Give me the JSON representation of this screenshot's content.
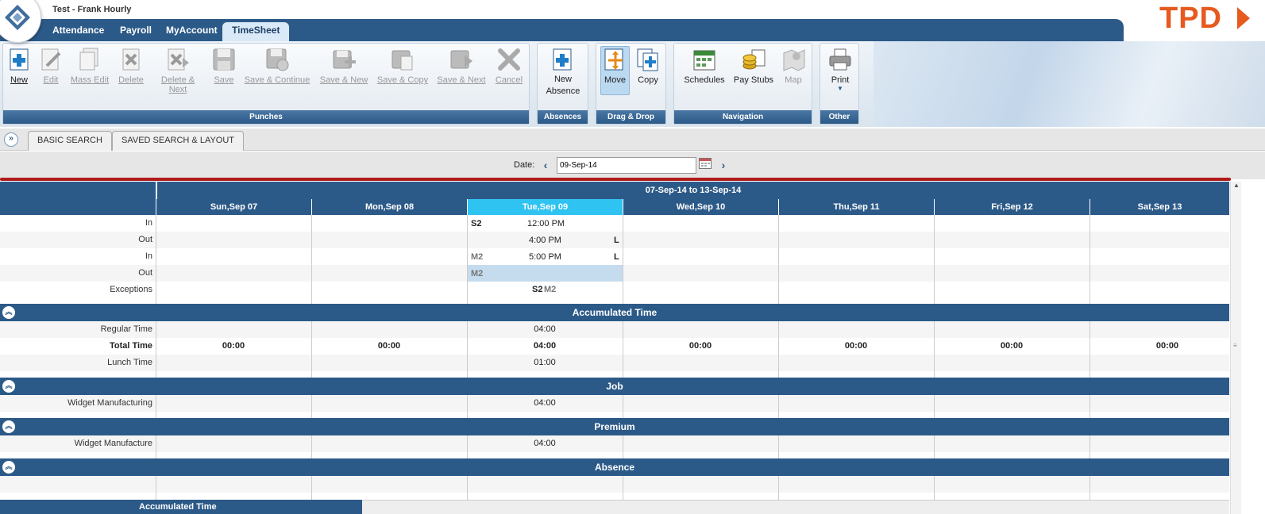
{
  "header": {
    "user_title": "Test - Frank Hourly",
    "brand": "TPD"
  },
  "nav": {
    "tabs": [
      "Attendance",
      "Payroll",
      "MyAccount",
      "TimeSheet"
    ],
    "active": "TimeSheet"
  },
  "ribbon": {
    "punches": {
      "label": "Punches",
      "buttons": [
        "New",
        "Edit",
        "Mass Edit",
        "Delete",
        "Delete & Next",
        "Save",
        "Save & Continue",
        "Save & New",
        "Save & Copy",
        "Save & Next",
        "Cancel"
      ]
    },
    "absences": {
      "label": "Absences",
      "button_line1": "New",
      "button_line2": "Absence"
    },
    "dragdrop": {
      "label": "Drag & Drop",
      "move": "Move",
      "copy": "Copy"
    },
    "navigation": {
      "label": "Navigation",
      "schedules": "Schedules",
      "paystubs": "Pay Stubs",
      "map": "Map"
    },
    "other": {
      "label": "Other",
      "print": "Print"
    }
  },
  "search": {
    "basic_tab": "BASIC SEARCH",
    "saved_tab": "SAVED SEARCH & LAYOUT"
  },
  "date": {
    "label": "Date:",
    "value": "09-Sep-14"
  },
  "grid": {
    "range": "07-Sep-14 to 13-Sep-14",
    "days": [
      "Sun,Sep 07",
      "Mon,Sep 08",
      "Tue,Sep 09",
      "Wed,Sep 10",
      "Thu,Sep 11",
      "Fri,Sep 12",
      "Sat,Sep 13"
    ],
    "punch_rows": [
      "In",
      "Out",
      "In",
      "Out",
      "Exceptions"
    ],
    "punches": {
      "in1_code": "S2",
      "in1_time": "12:00 PM",
      "out1_time": "4:00 PM",
      "out1_flag": "L",
      "in2_code": "M2",
      "in2_time": "5:00 PM",
      "in2_flag": "L",
      "out2_code": "M2",
      "exc1": "S2",
      "exc2": "M2"
    },
    "accumulated": {
      "title": "Accumulated Time",
      "regular_label": "Regular Time",
      "regular_value": "04:00",
      "total_label": "Total Time",
      "total_values": [
        "00:00",
        "00:00",
        "04:00",
        "00:00",
        "00:00",
        "00:00",
        "00:00"
      ],
      "lunch_label": "Lunch Time",
      "lunch_value": "01:00"
    },
    "job": {
      "title": "Job",
      "label": "Widget Manufacturing",
      "value": "04:00"
    },
    "premium": {
      "title": "Premium",
      "label": "Widget Manufacture",
      "value": "04:00"
    },
    "absence": {
      "title": "Absence"
    },
    "footer": "Accumulated Time"
  }
}
